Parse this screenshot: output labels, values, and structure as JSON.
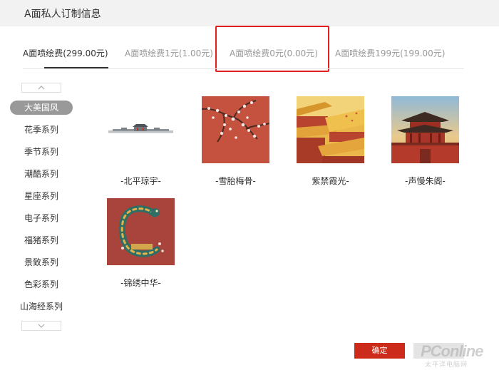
{
  "header": {
    "title": "A面私人订制信息"
  },
  "tabs": [
    {
      "label": "A面喷绘费(299.00元)"
    },
    {
      "label": "A面喷绘费1元(1.00元)"
    },
    {
      "label": "A面喷绘费0元(0.00元)"
    },
    {
      "label": "A面喷绘费199元(199.00元)"
    }
  ],
  "categories": [
    {
      "label": "大美国风"
    },
    {
      "label": "花季系列"
    },
    {
      "label": "季节系列"
    },
    {
      "label": "潮酷系列"
    },
    {
      "label": "星座系列"
    },
    {
      "label": "电子系列"
    },
    {
      "label": "福猪系列"
    },
    {
      "label": "景致系列"
    },
    {
      "label": "色彩系列"
    },
    {
      "label": "山海经系列"
    }
  ],
  "designs": [
    {
      "caption": "-北平琼宇-",
      "icon": "skyline-icon"
    },
    {
      "caption": "-雪胎梅骨-",
      "icon": "plum-blossom-icon"
    },
    {
      "caption": "紫禁霞光-",
      "icon": "palace-roof-icon"
    },
    {
      "caption": "-声慢朱阁-",
      "icon": "pavilion-icon"
    },
    {
      "caption": "-锦绣中华-",
      "icon": "dragon-icon"
    }
  ],
  "actions": {
    "confirm_label": "确定"
  },
  "watermark": {
    "brand": "PConline",
    "sub": "太平洋电脑网"
  },
  "colors": {
    "accent": "#cc2a1a",
    "active_category_bg": "#999999",
    "highlight": "#e02020"
  }
}
